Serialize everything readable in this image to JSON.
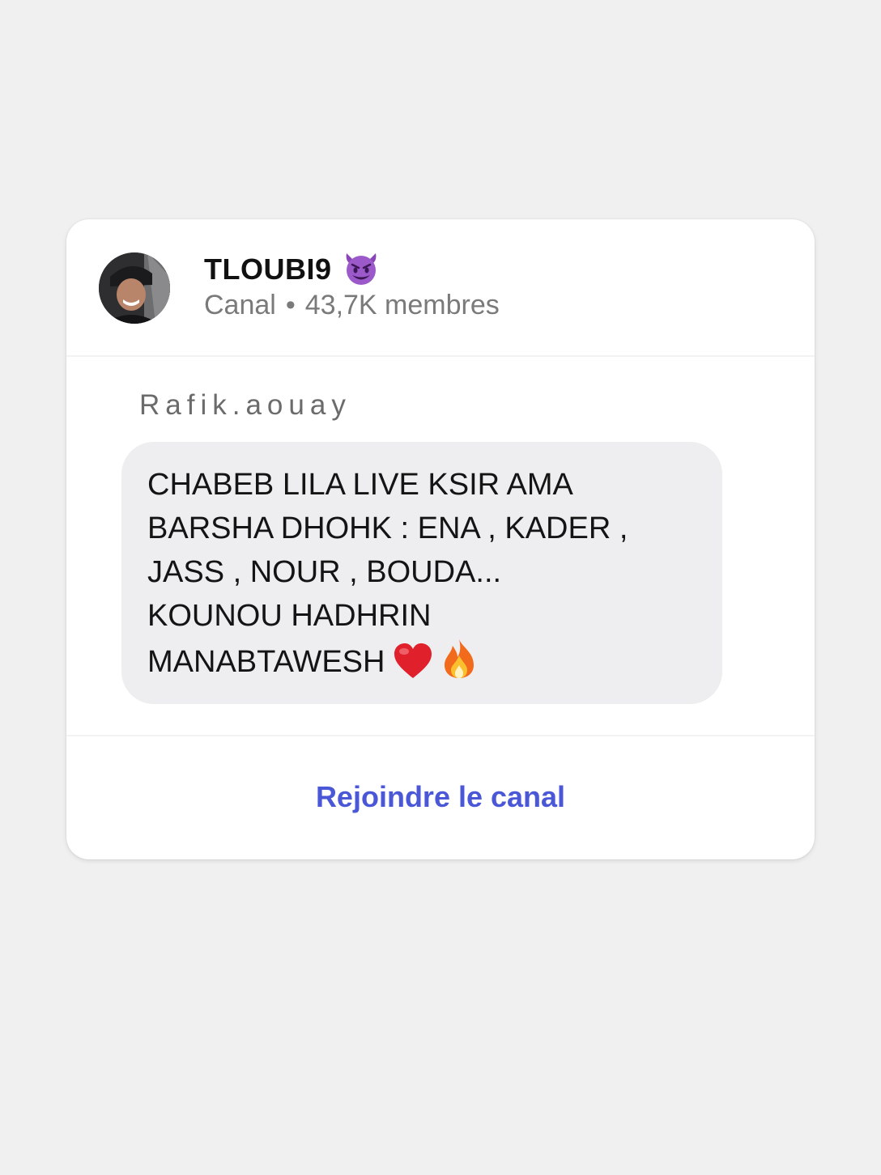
{
  "channel": {
    "name": "TLOUBI9",
    "name_emoji": "smiling-devil-emoji",
    "type_label": "Canal",
    "separator": "•",
    "members": "43,7K membres"
  },
  "post": {
    "sender": "Rafik.aouay",
    "message_lines": [
      "CHABEB LILA LIVE KSIR AMA",
      "BARSHA DHOHK : ENA , KADER ,",
      "JASS , NOUR , BOUDA...",
      "KOUNOU HADHRIN",
      "MANABTAWESH"
    ],
    "trailing_emojis": [
      "red-heart-emoji",
      "fire-emoji"
    ]
  },
  "actions": {
    "join_label": "Rejoindre le canal"
  },
  "colors": {
    "background": "#f0f0f1",
    "card": "#ffffff",
    "bubble": "#eeeef0",
    "accent": "#4a57d6",
    "muted_text": "#7a7a7a"
  }
}
